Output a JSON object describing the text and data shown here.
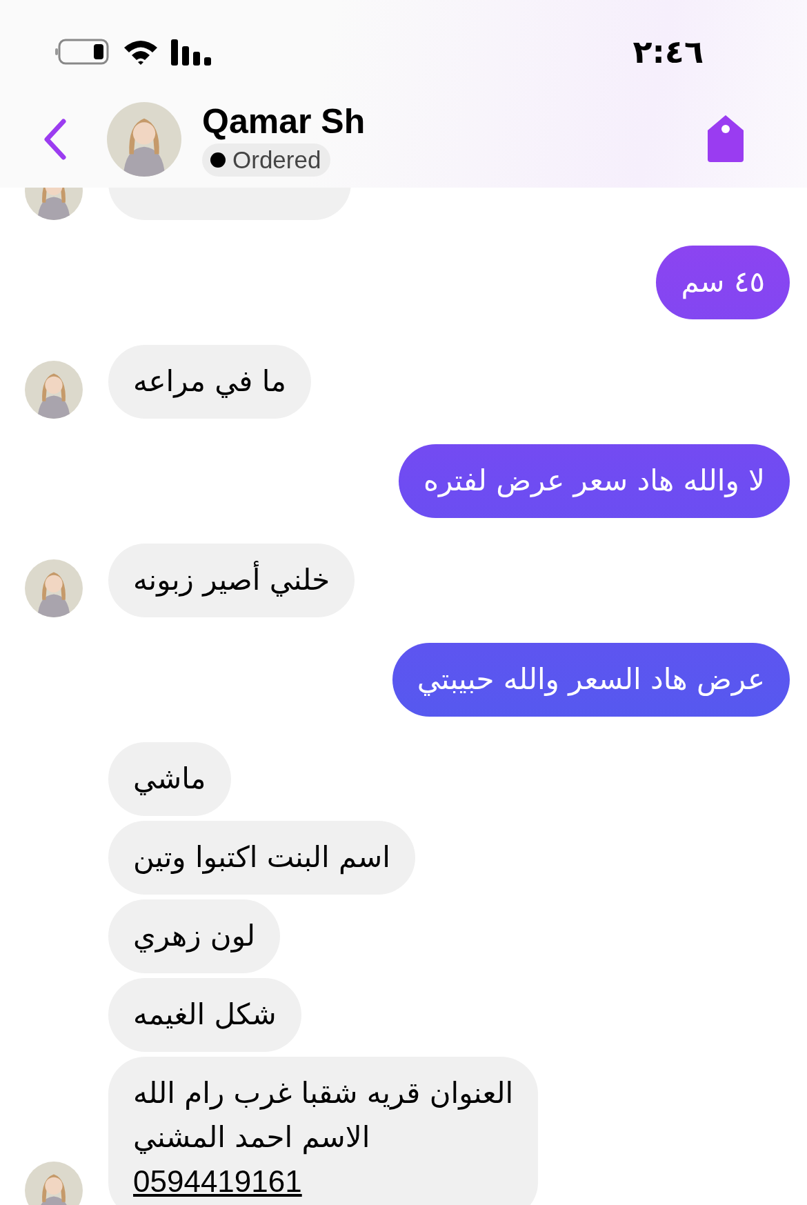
{
  "status_bar": {
    "time": "٢:٤٦"
  },
  "header": {
    "name": "Qamar Sh",
    "status": "Ordered"
  },
  "messages": [
    {
      "kind": "incoming",
      "partial": true,
      "avatar": true
    },
    {
      "kind": "outgoing",
      "text": "٤٥ سم"
    },
    {
      "kind": "incoming",
      "text": "ما في مراعه",
      "avatar": true
    },
    {
      "kind": "outgoing",
      "text": "لا والله هاد سعر عرض لفتره"
    },
    {
      "kind": "incoming",
      "text": "خلني أصير زبونه",
      "avatar": true
    },
    {
      "kind": "outgoing",
      "text": "عرض هاد السعر والله حبيبتي"
    },
    {
      "kind": "incoming",
      "text": "ماشي",
      "avatar": false
    },
    {
      "kind": "incoming",
      "text": "اسم البنت اكتبوا وتين",
      "avatar": false
    },
    {
      "kind": "incoming",
      "text": "لون زهري",
      "avatar": false
    },
    {
      "kind": "incoming",
      "text": "شكل الغيمه",
      "avatar": false
    },
    {
      "kind": "incoming",
      "lines": [
        "العنوان قريه شقبا غرب رام الله",
        "الاسم احمد المشني"
      ],
      "phone": "0594419161",
      "avatar": true
    }
  ]
}
